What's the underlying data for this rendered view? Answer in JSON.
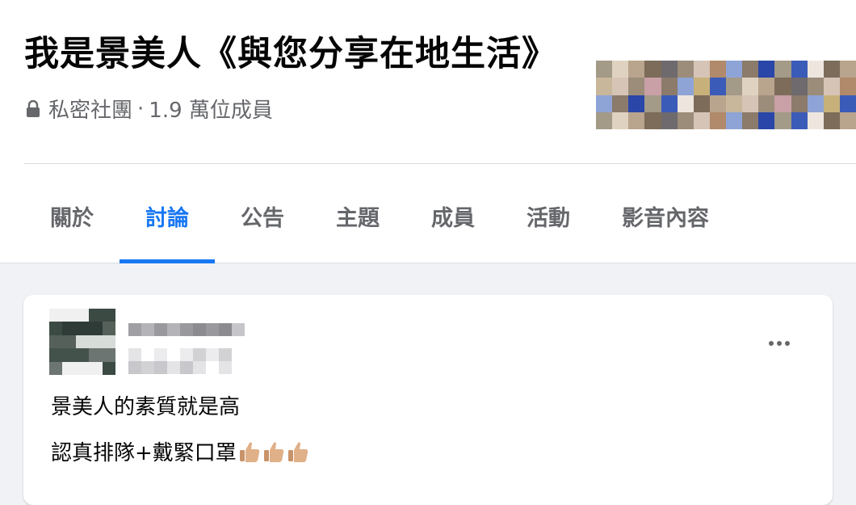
{
  "group": {
    "title": "我是景美人《與您分享在地生活》",
    "privacy": "私密社團",
    "separator": "·",
    "members": "1.9 萬位成員",
    "privacy_icon": "lock-icon"
  },
  "tabs": [
    {
      "label": "關於"
    },
    {
      "label": "討論",
      "active": true
    },
    {
      "label": "公告"
    },
    {
      "label": "主題"
    },
    {
      "label": "成員"
    },
    {
      "label": "活動"
    },
    {
      "label": "影音內容"
    }
  ],
  "post": {
    "line1": "景美人的素質就是高",
    "line2": "認真排隊+戴緊口罩",
    "emoji": [
      "thumbs-up-icon",
      "thumbs-up-icon",
      "thumbs-up-icon"
    ],
    "more_icon": "more-horizontal-icon"
  },
  "colors": {
    "accent": "#1877f2",
    "secondary_text": "#65676b",
    "page_bg": "#f0f2f5"
  }
}
